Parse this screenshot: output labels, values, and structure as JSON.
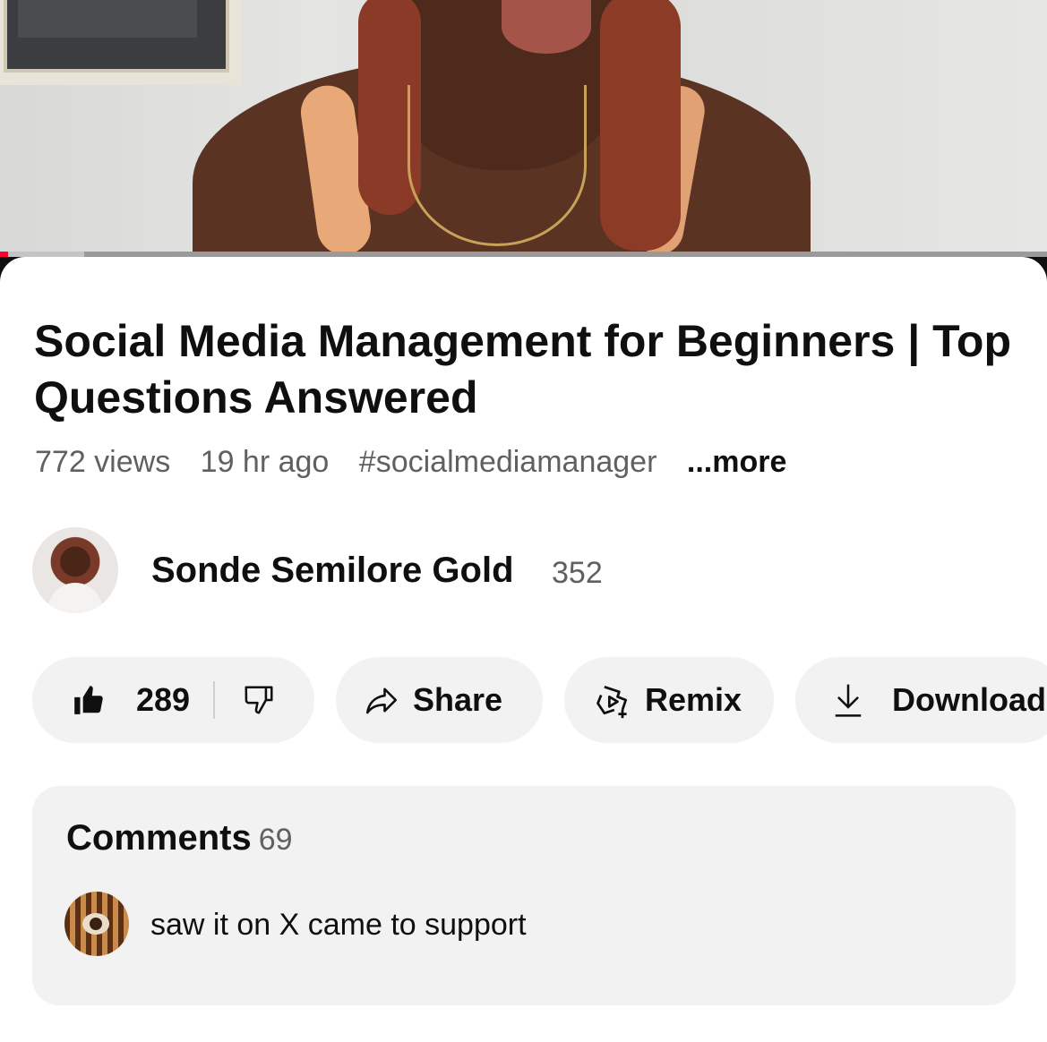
{
  "video": {
    "progress_fraction": 0.008,
    "buffered_fraction": 0.08,
    "progress_color": "#ff0033"
  },
  "title": "Social Media Management for Beginners | Top Questions Answered",
  "meta": {
    "views": "772 views",
    "age": "19 hr ago",
    "hashtag": "#socialmediamanager",
    "more": "...more"
  },
  "channel": {
    "name": "Sonde Semilore Gold",
    "subscribers": "352"
  },
  "actions": {
    "like_count": "289",
    "like_icon": "thumbs-up-filled-icon",
    "dislike_icon": "thumbs-down-icon",
    "share_label": "Share",
    "remix_label": "Remix",
    "download_label": "Download"
  },
  "comments": {
    "title": "Comments",
    "count": "69",
    "top_comment": "saw it on X came to support"
  }
}
